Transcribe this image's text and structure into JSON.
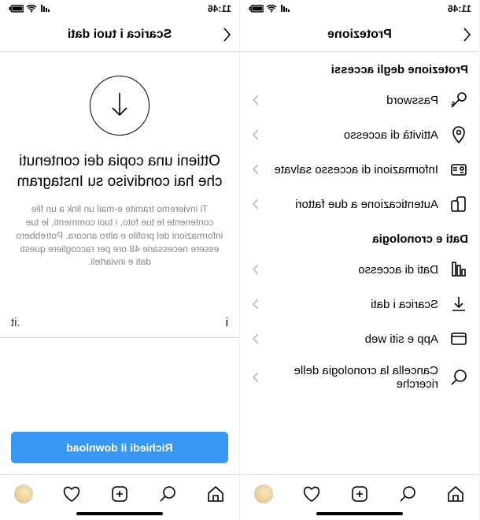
{
  "status": {
    "time": "11:46"
  },
  "left": {
    "title": "Scarica i tuoi dati",
    "headline": "Ottieni una copia dei contenuti che hai condiviso su Instagram",
    "description": "Ti invieremo tramite e-mail un link a un file contenente le tue foto, i tuoi commenti, le tue informazioni del profilo e altro ancora. Potrebbero essere necessarie 48 ore per raccogliere questi dati e inviarteli.",
    "email_value": "i",
    "email_suffix": ".it",
    "button": "Richiedi il download"
  },
  "right": {
    "title": "Protezione",
    "section1": "Protezione degli accessi",
    "items1": {
      "password": "Password",
      "login_activity": "Attività di accesso",
      "saved_login": "Informazioni di accesso salvate",
      "two_factor": "Autenticazione a due fattori"
    },
    "section2": "Dati e cronologia",
    "items2": {
      "access_data": "Dati di accesso",
      "download_data": "Scarica i dati",
      "apps_websites": "App e siti web",
      "clear_history": "Cancella la cronologia delle ricerche"
    }
  }
}
